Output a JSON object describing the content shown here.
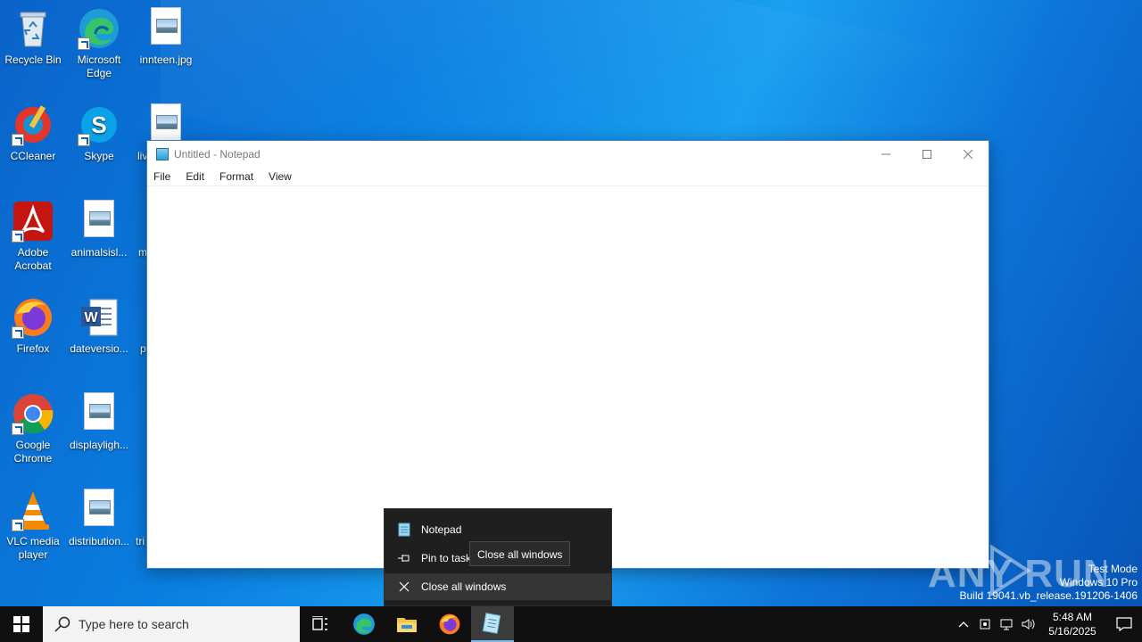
{
  "desktop": {
    "icons": [
      {
        "label": "Recycle Bin",
        "icon": "recycle-bin-icon"
      },
      {
        "label": "Microsoft Edge",
        "icon": "edge-icon"
      },
      {
        "label": "innteen.jpg",
        "icon": "image-file-icon"
      },
      {
        "label": "CCleaner",
        "icon": "ccleaner-icon"
      },
      {
        "label": "Skype",
        "icon": "skype-icon"
      },
      {
        "label": "liv",
        "icon": "image-file-icon"
      },
      {
        "label": "Adobe Acrobat",
        "icon": "acrobat-icon"
      },
      {
        "label": "animalsisl...",
        "icon": "image-file-icon"
      },
      {
        "label": "m",
        "icon": "file-icon"
      },
      {
        "label": "Firefox",
        "icon": "firefox-icon"
      },
      {
        "label": "dateversio...",
        "icon": "word-doc-icon"
      },
      {
        "label": "p",
        "icon": "file-icon"
      },
      {
        "label": "Google Chrome",
        "icon": "chrome-icon"
      },
      {
        "label": "displayligh...",
        "icon": "image-file-icon"
      },
      {
        "label": "VLC media player",
        "icon": "vlc-icon"
      },
      {
        "label": "distribution...",
        "icon": "image-file-icon"
      },
      {
        "label": "tri",
        "icon": "file-icon"
      }
    ]
  },
  "notepad": {
    "title": "Untitled - Notepad",
    "menu": [
      "File",
      "Edit",
      "Format",
      "View"
    ],
    "content": ""
  },
  "jumplist": {
    "app_label": "Notepad",
    "pin_label": "Pin to task",
    "close_label": "Close all windows"
  },
  "tooltip": {
    "text": "Close all windows"
  },
  "watermark": {
    "text": "ANY RUN"
  },
  "system_info": {
    "line1": "Test Mode",
    "line2": "Windows 10 Pro",
    "line3": "Build 19041.vb_release.191206-1406"
  },
  "taskbar": {
    "search_placeholder": "Type here to search",
    "time": "5:48 AM",
    "date": "5/16/2025"
  },
  "colors": {
    "taskbar_bg": "#101010",
    "jumplist_bg": "#1f1f1f",
    "accent": "#76b9ed"
  }
}
